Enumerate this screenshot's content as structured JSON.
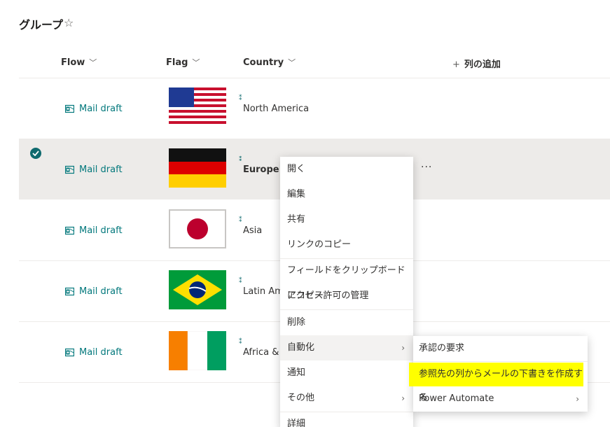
{
  "page": {
    "title": "グループ",
    "star_icon": "star-icon"
  },
  "columns": {
    "flow": "Flow",
    "flag": "Flag",
    "country": "Country",
    "add_column": "列の追加"
  },
  "rows": [
    {
      "mail": "Mail draft",
      "country": "North America",
      "flag": "usa-flag"
    },
    {
      "mail": "Mail draft",
      "country": "Europe",
      "flag": "germany-flag",
      "selected": true
    },
    {
      "mail": "Mail draft",
      "country": "Asia",
      "flag": "japan-flag"
    },
    {
      "mail": "Mail draft",
      "country": "Latin Am",
      "flag": "brazil-flag"
    },
    {
      "mail": "Mail draft",
      "country": "Africa &",
      "flag": "ivory-coast-flag"
    }
  ],
  "more_icon": "···",
  "context_menu": {
    "items": [
      "開く",
      "編集",
      "共有",
      "リンクのコピー",
      "フィールドをクリップボードにコピー",
      "アクセス許可の管理",
      "削除",
      "自動化",
      "通知",
      "その他",
      "詳細"
    ]
  },
  "submenu": {
    "items": [
      "承認の要求",
      "参照先の列からメールの下書きを作成する",
      "Power Automate"
    ]
  },
  "colors": {
    "accent": "#03787c",
    "highlight": "#ffff00",
    "selected_row": "#edebe9"
  }
}
